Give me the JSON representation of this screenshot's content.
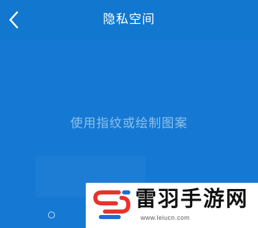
{
  "header": {
    "title": "隐私空间",
    "back_icon": "chevron-left-icon"
  },
  "main": {
    "hint_text": "使用指纹或绘制图案"
  },
  "indicator": {
    "icon": "circle-outline-icon"
  },
  "watermark": {
    "site_name": "雷羽手游网",
    "url": "www.leiucn.com"
  },
  "colors": {
    "background": "#1579d3",
    "header": "#1277cf",
    "logo_red": "#e8332b",
    "logo_blue": "#1a6fd8"
  }
}
